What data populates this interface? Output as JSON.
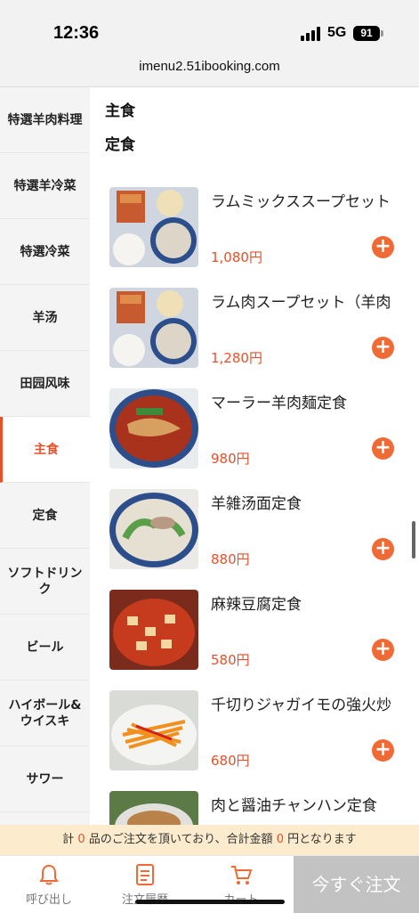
{
  "status_bar": {
    "time": "12:36",
    "network": "5G",
    "battery": "91"
  },
  "url": "imenu2.51ibooking.com",
  "sidebar": {
    "items": [
      {
        "label": "特選羊肉料理",
        "active": false
      },
      {
        "label": "特選羊冷菜",
        "active": false
      },
      {
        "label": "特選冷菜",
        "active": false
      },
      {
        "label": "羊汤",
        "active": false
      },
      {
        "label": "田园风味",
        "active": false
      },
      {
        "label": "主食",
        "active": true
      },
      {
        "label": "定食",
        "active": false
      },
      {
        "label": "ソフトドリンク",
        "active": false
      },
      {
        "label": "ビール",
        "active": false
      },
      {
        "label": "ハイボール&ウイスキ",
        "active": false
      },
      {
        "label": "サワー",
        "active": false
      },
      {
        "label": "",
        "active": false
      }
    ]
  },
  "main": {
    "category_title": "主食",
    "subcategory_title": "定食",
    "items": [
      {
        "name": "ラムミックススープセット",
        "price": "1,080円",
        "image": "lamb-soup-set-photo"
      },
      {
        "name": "ラム肉スープセット（羊肉",
        "price": "1,280円",
        "image": "lamb-soup-set-photo"
      },
      {
        "name": "マーラー羊肉麺定食",
        "price": "980円",
        "image": "spicy-noodle-photo"
      },
      {
        "name": "羊雑汤面定食",
        "price": "880円",
        "image": "white-noodle-soup-photo"
      },
      {
        "name": "麻辣豆腐定食",
        "price": "580円",
        "image": "mapo-tofu-photo"
      },
      {
        "name": "千切りジャガイモの強火炒",
        "price": "680円",
        "image": "shredded-potato-photo"
      },
      {
        "name": "肉と醤油チャンハン定食",
        "price": "",
        "image": "fried-rice-photo"
      }
    ],
    "add_symbol": "+"
  },
  "summary": {
    "prefix": "計",
    "count": "0",
    "middle": "品のご注文を頂いており、合計金額",
    "amount": "0",
    "suffix": "円となります"
  },
  "bottom_nav": {
    "call_label": "呼び出し",
    "history_label": "注文履歴",
    "cart_label": "カート",
    "order_now_label": "今すぐ注文"
  },
  "colors": {
    "accent": "#e8502a",
    "add_button": "#f06a35",
    "summary_bg": "#fcebcd",
    "order_button": "#c2c2c2"
  }
}
